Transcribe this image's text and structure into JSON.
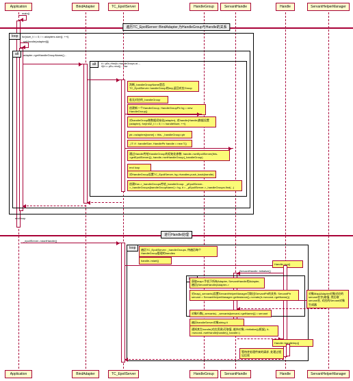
{
  "participants": {
    "p1": "Application",
    "p2": "BindAdapter",
    "p3": "TC_EpollServer",
    "p4": "HandleGroup",
    "p5": "ServantHandle",
    "p6": "Handle",
    "p7": "ServantHelperManager"
  },
  "dividers": {
    "d1": "遍历TC_EpollServer::BindAdapter,为HandleGroup与Handle的关系",
    "d2": "进行Handle处理"
  },
  "frames": {
    "f1": "loop",
    "f1_cond": "for(size_t i = 0; i < adapters.size(); ++i)",
    "f2": "alt",
    "f2_cond": "adapter->getHandleGroupName()...",
    "f3": "alt",
    "f3_cond": "it = pEs->find(h->handleGroups.at..., if(it == pEs->end()... else",
    "f4": "loop",
    "f5": "loop"
  },
  "messages": {
    "m1": "main()",
    "m2": "setHandle(adapter[i])",
    "m3": "setHandle<ServantHandle>()",
    "m4": "判断_handleGroupName是否TC_EpollServer::handleGroup的key,返回对应Group",
    "m5": "若无对应的_handleGroup",
    "m6": "创建新一个HandleGroup, HandleGroupPtr hg = new HandleGroup()",
    "m7": "对handleGroup做数据初始化(adapter), 对handle(Handle)数据设置(adapter), for(int32_t i = 0; i < handleNum; ++i)",
    "m8": "ptr->adapters[name] = this, _handleGroup=ptr",
    "m9": "_IT: if : handleSize, HandlePtr handle = new T()",
    "m10": "通过Handle传给HandleGroup的初始化参数: handle->setEpollServer(this->getEpollServer()), handle->setHandleGroup(_handleGroup)",
    "m11": "end loop",
    "m12": "对HandleGroup设置TC_EpollServer, hg->handles.push_back(handle)",
    "m13": "创建Ese->_handleGroups传给_handleGroup: _pEpollServer->_handleGroups[handleGroupName] = hg, it = _pEpollServer->_handleGroups.find(...)",
    "m14": "end loop",
    "m15": "_epollServer->startHandle()",
    "m16": "遍历TC_EpollServer::_handleGroups, 待遍历每个HandleGroup管理的handles",
    "m17": "handle->start()",
    "m18": "Handle::run()",
    "m19": "ServantHandle::Initialize()",
    "m20": "获取map<手机下所有Adapter, ServantHandle的Adapter, 遍历(ServantHandle)Adapter->",
    "m21": "对map(_servants)设置ServantHelperManager可取出ServantPtr的关系: ServantPtr servant = ServantHelperManager::getInstance()->create(it->second->getName())",
    "m22": "对象Map(Adapter对象对应的servant名字)取值, 然后取servant名, 对应的Servant对象生成器",
    "m23": "对象行数(_servants), _servants[servant->getName()] = servant",
    "m24": "遍历handleServer对象string it",
    "m25": "通知其生handle(对应资源)可取值, 维持对象->initialize()(框架), it->second->setHandle(handle)(_handle=)",
    "m26": "Handle::handleImp()",
    "m27": "等待并处理传来的请求, 处理过程见后续"
  }
}
